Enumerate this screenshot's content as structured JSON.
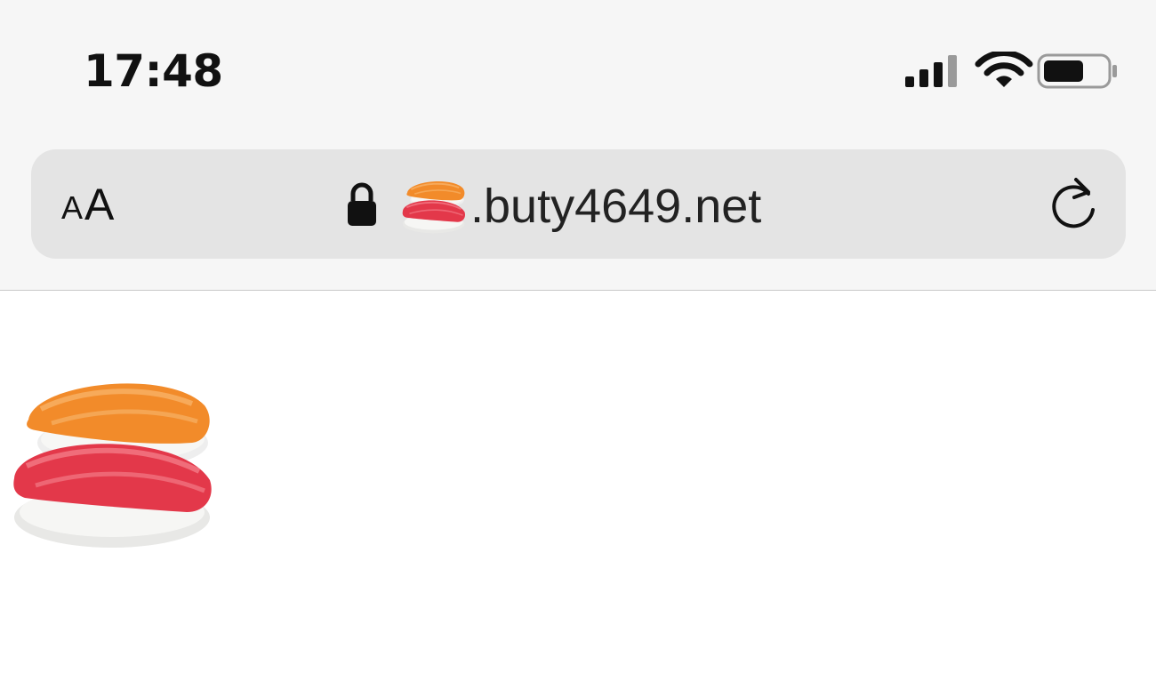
{
  "status_bar": {
    "time": "17:48",
    "icons": [
      "cellular-signal-icon",
      "wifi-icon",
      "battery-icon"
    ],
    "battery_level": 0.6
  },
  "address_bar": {
    "text_size_button": {
      "small": "A",
      "large": "A"
    },
    "secure_icon": "lock-icon",
    "domain_emoji": "sushi-emoji",
    "domain_text": ".buty4649.net",
    "reload_icon": "reload-icon"
  },
  "page": {
    "content_emoji": "sushi-emoji"
  },
  "colors": {
    "chrome_background": "#f6f6f6",
    "address_bar_background": "#e4e4e4",
    "page_background": "#ffffff",
    "text": "#111111"
  }
}
